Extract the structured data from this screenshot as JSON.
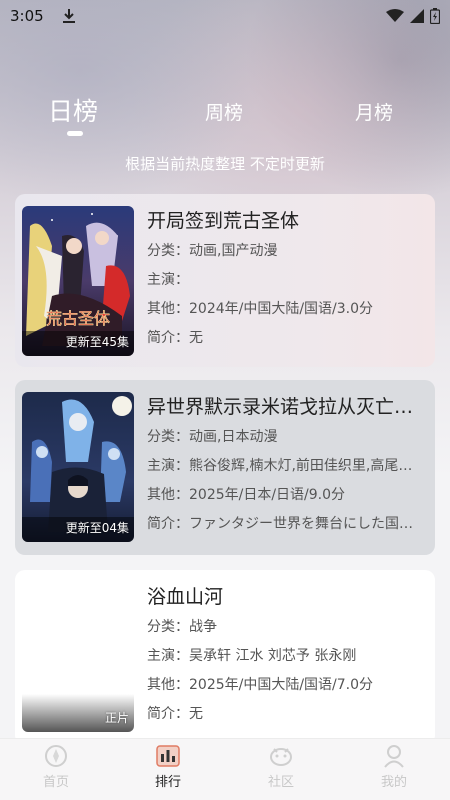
{
  "status_bar": {
    "time": "3:05"
  },
  "tabs": [
    {
      "label": "日榜"
    },
    {
      "label": "周榜"
    },
    {
      "label": "月榜"
    }
  ],
  "subtitle": "根据当前热度整理 不定时更新",
  "items": [
    {
      "title": "开局签到荒古圣体",
      "category": "分类：动画,国产动漫",
      "cast": "主演：",
      "other": "其他：2024年/中国大陆/国语/3.0分",
      "intro": "简介：无",
      "badge": "更新至45集",
      "poster_title_art": "荒古圣体"
    },
    {
      "title": "异世界默示录米诺戈拉从灭亡…",
      "category": "分类：动画,日本动漫",
      "cast": "主演：熊谷俊辉,楠木灯,前田佳织里,高尾…",
      "other": "其他：2025年/日本/日语/9.0分",
      "intro": "简介：ファンタジー世界を舞台にした国…",
      "badge": "更新至04集"
    },
    {
      "title": "浴血山河",
      "category": "分类：战争",
      "cast": "主演：吴承轩 江水 刘芯予 张永刚",
      "other": "其他：2025年/中国大陆/国语/7.0分",
      "intro": "简介：无",
      "badge": "正片"
    }
  ],
  "bottom_nav": [
    {
      "label": "首页",
      "icon": "home-icon"
    },
    {
      "label": "排行",
      "icon": "ranking-icon"
    },
    {
      "label": "社区",
      "icon": "community-icon"
    },
    {
      "label": "我的",
      "icon": "profile-icon"
    }
  ],
  "colors": {
    "tab_text": "#ffffff",
    "card_text": "#555555",
    "nav_inactive": "#c8c8c8",
    "nav_active": "#222222"
  }
}
